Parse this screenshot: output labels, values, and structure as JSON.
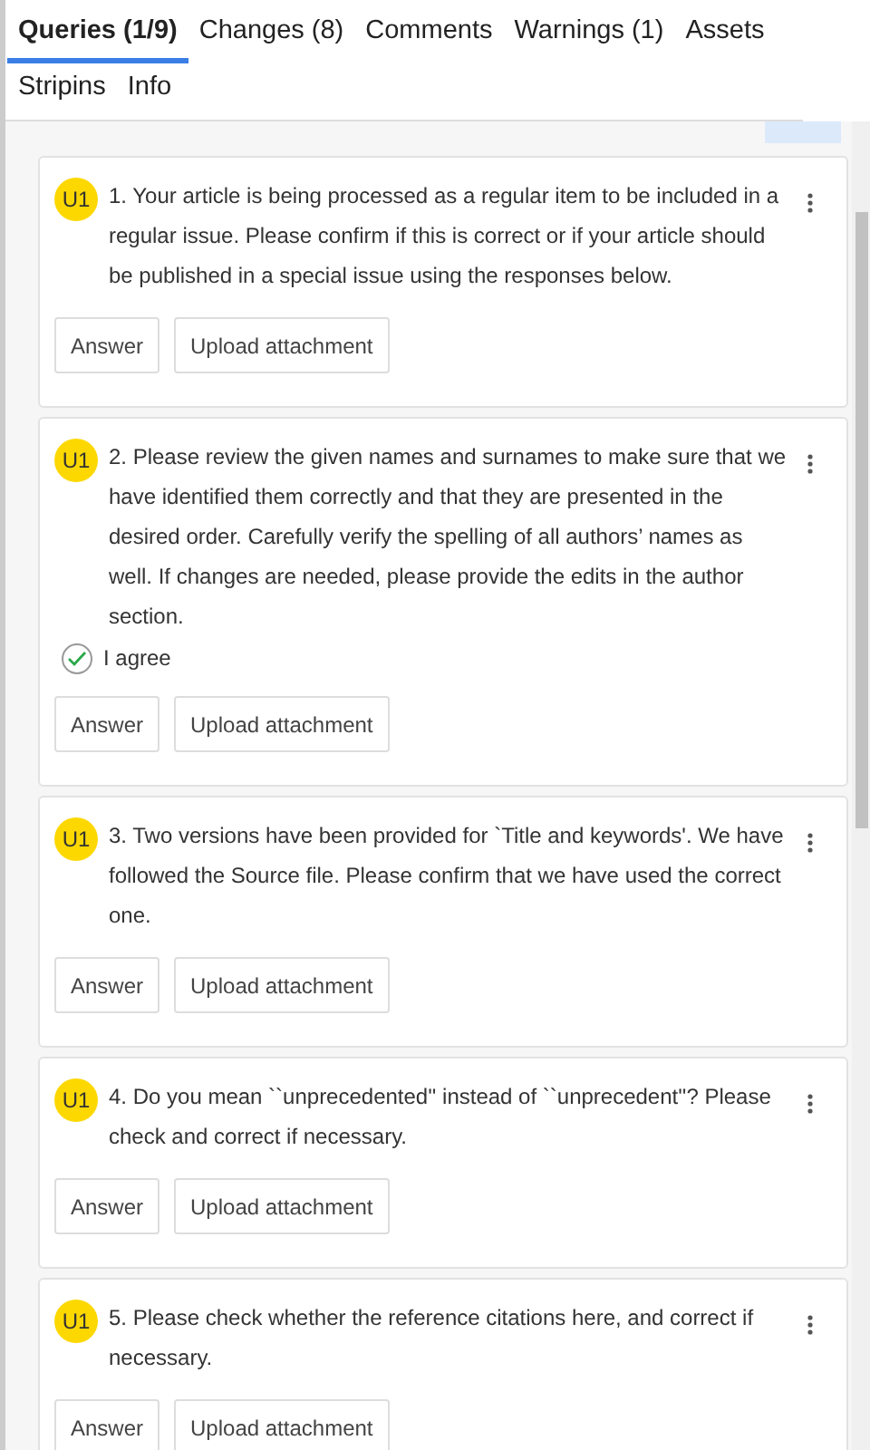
{
  "tabs": [
    {
      "label": "Queries (1/9)",
      "selected": true
    },
    {
      "label": "Changes (8)",
      "selected": false
    },
    {
      "label": "Comments",
      "selected": false
    },
    {
      "label": "Warnings (1)",
      "selected": false
    },
    {
      "label": "Assets",
      "selected": false
    },
    {
      "label": "Stripins",
      "selected": false
    },
    {
      "label": "Info",
      "selected": false
    }
  ],
  "queries": [
    {
      "badge": "U1",
      "text": "1. Your article is being processed as a regular item to be included in a regular issue. Please confirm if this is correct or if your article should be published in a special issue using the responses below.",
      "actions": [
        "Answer",
        "Upload attachment"
      ]
    },
    {
      "badge": "U1",
      "text": "2. Please review the given names and surnames to make sure that we have identified them correctly and that they are presented in the desired order. Carefully verify the spelling of all authors’ names as well. If changes are needed, please provide the edits in the author section.",
      "agreement": {
        "label": "I agree",
        "checked": true
      },
      "actions": [
        "Answer",
        "Upload attachment"
      ]
    },
    {
      "badge": "U1",
      "text": "3. Two versions have been provided for `Title and keywords'. We have followed the Source file. Please confirm that we have used the correct one.",
      "actions": [
        "Answer",
        "Upload attachment"
      ]
    },
    {
      "badge": "U1",
      "text": "4. Do you mean ``unprecedented'' instead of ``unprecedent''? Please check and correct if necessary.",
      "actions": [
        "Answer",
        "Upload attachment"
      ]
    },
    {
      "badge": "U1",
      "text": "5. Please check whether the reference citations here, and correct if necessary.",
      "actions": [
        "Answer",
        "Upload attachment"
      ]
    }
  ]
}
